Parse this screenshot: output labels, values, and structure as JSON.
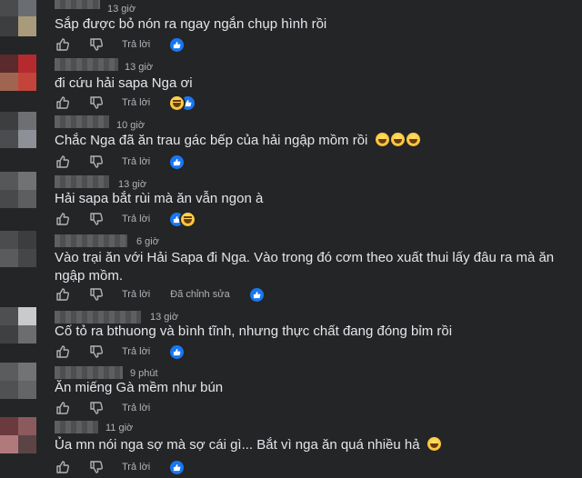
{
  "ui": {
    "like_icon": "thumbs-up-icon",
    "dislike_icon": "thumbs-down-icon",
    "colors": {
      "background": "#242526",
      "text": "#e4e6eb",
      "muted": "#b0b3b8",
      "accent": "#1877f2"
    }
  },
  "comments": [
    {
      "time": "13 giờ",
      "text": "Sắp được bỏ nón ra ngay ngắn chụp hình rồi",
      "reply": "Trả lời",
      "reactions": [
        "like"
      ]
    },
    {
      "time": "13 giờ",
      "text": "đi cứu hải sapa Nga ơi",
      "reply": "Trả lời",
      "reactions": [
        "haha",
        "like"
      ]
    },
    {
      "time": "10 giờ",
      "text": "Chắc Nga đã ăn trau gác bếp của hải ngập mồm rồi",
      "emoji_count": 3,
      "reply": "Trả lời",
      "reactions": [
        "like"
      ]
    },
    {
      "time": "13 giờ",
      "text": "Hải sapa bắt rùi mà ăn vẫn ngon à",
      "reply": "Trả lời",
      "reactions": [
        "like",
        "haha"
      ]
    },
    {
      "time": "6 giờ",
      "text": "Vào trại ăn với Hải Sapa đi Nga. Vào trong đó cơm theo xuất thui lấy đâu ra mà ăn ngập mồm.",
      "reply": "Trả lời",
      "edited": "Đã chỉnh sửa",
      "reactions": [
        "like"
      ]
    },
    {
      "time": "13 giờ",
      "text": "Cố tỏ ra bthuong và bình tĩnh, nhưng thực chất đang đóng bỉm rồi",
      "reply": "Trả lời",
      "reactions": [
        "like"
      ]
    },
    {
      "time": "9 phút",
      "text": "Ăn miếng Gà mềm như bún",
      "reply": "Trả lời",
      "reactions": []
    },
    {
      "time": "11 giờ",
      "text": "Ủa mn nói nga sợ mà sợ cái gì... Bắt vì nga ăn quá nhiều hả",
      "emoji_count": 1,
      "reply": "Trả lời",
      "reactions": [
        "like"
      ]
    }
  ]
}
